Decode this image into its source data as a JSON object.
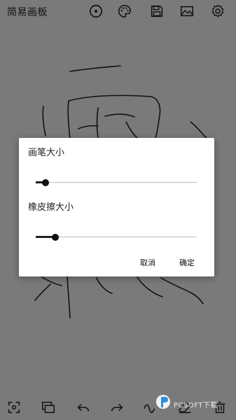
{
  "app": {
    "title": "简易画板"
  },
  "toolbar_top": [
    {
      "icon": "record-circle-icon"
    },
    {
      "icon": "palette-icon"
    },
    {
      "icon": "save-floppy-icon"
    },
    {
      "icon": "image-icon"
    },
    {
      "icon": "settings-gear-icon"
    }
  ],
  "dialog": {
    "pen_label": "画笔大小",
    "pen_value": 0.06,
    "eraser_label": "橡皮擦大小",
    "eraser_value": 0.12,
    "cancel": "取消",
    "confirm": "确定"
  },
  "toolbar_bottom": [
    {
      "icon": "fullscreen-icon"
    },
    {
      "icon": "layers-icon"
    },
    {
      "icon": "undo-icon"
    },
    {
      "icon": "redo-icon"
    },
    {
      "icon": "pen-curve-icon"
    },
    {
      "icon": "eraser-icon"
    },
    {
      "icon": "delete-icon"
    }
  ],
  "watermark": {
    "text": "PCSOFT下载"
  },
  "colors": {
    "background": "#7a7a7a",
    "dialog": "#ffffff",
    "ink": "#111111"
  }
}
